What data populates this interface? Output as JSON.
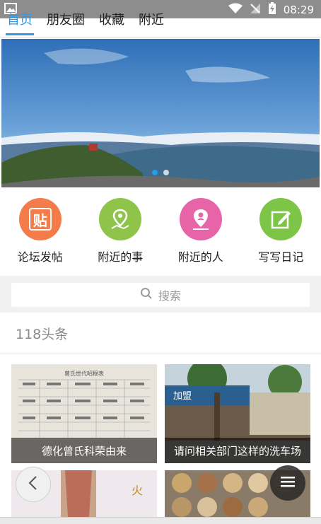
{
  "status_bar": {
    "time": "08:29",
    "icons": [
      "image-icon",
      "wifi-icon",
      "signal-off-icon",
      "battery-icon"
    ]
  },
  "tabs": [
    {
      "label": "首页",
      "active": true
    },
    {
      "label": "朋友圈",
      "active": false
    },
    {
      "label": "收藏",
      "active": false
    },
    {
      "label": "附近",
      "active": false
    }
  ],
  "banner": {
    "slides": 2,
    "active_slide": 1
  },
  "quick_actions": [
    {
      "label": "论坛发帖",
      "icon": "post-icon",
      "color": "#f47c4b",
      "glyph": "贴"
    },
    {
      "label": "附近的事",
      "icon": "location-event-icon",
      "color": "#8dc449"
    },
    {
      "label": "附近的人",
      "icon": "location-person-icon",
      "color": "#e864a8"
    },
    {
      "label": "写写日记",
      "icon": "diary-edit-icon",
      "color": "#7cc546"
    }
  ],
  "search": {
    "placeholder": "搜索",
    "icon": "search-icon"
  },
  "section": {
    "title": "118头条"
  },
  "news": [
    {
      "caption": "德化曾氏科荣由来"
    },
    {
      "caption": "请问相关部门这样的洗车场"
    },
    {
      "caption": ""
    },
    {
      "caption": ""
    }
  ],
  "card_text": {
    "table_header": "曾氏世代昭穆表",
    "sign_text": "加盟",
    "fire_char": "火"
  },
  "floating": {
    "back_icon": "chevron-left-icon",
    "menu_icon": "hamburger-menu-icon"
  },
  "colors": {
    "accent": "#2b9be8",
    "status_bar": "#8d8d8d"
  }
}
